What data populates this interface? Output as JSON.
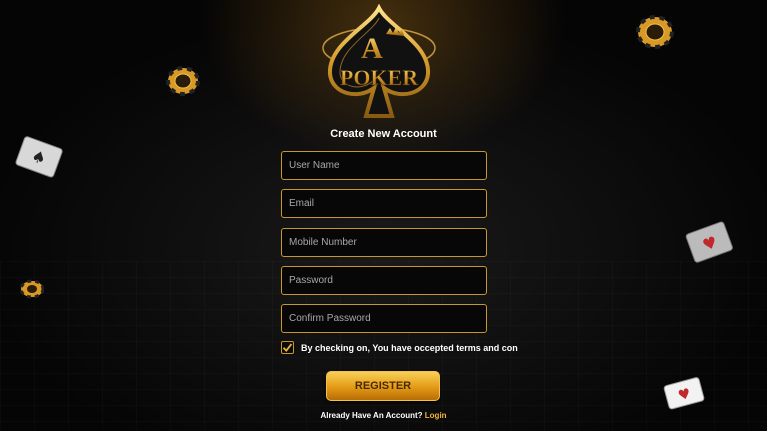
{
  "brand": {
    "logo_letter": "A",
    "logo_word": "POKER"
  },
  "form": {
    "title": "Create New Account",
    "fields": [
      {
        "name": "username",
        "placeholder": "User Name"
      },
      {
        "name": "email",
        "placeholder": "Email"
      },
      {
        "name": "mobile",
        "placeholder": "Mobile Number"
      },
      {
        "name": "password",
        "placeholder": "Password"
      },
      {
        "name": "confirm_password",
        "placeholder": "Confirm Password"
      }
    ],
    "terms_checked": true,
    "terms_text": "By checking on, You have occepted terms and con",
    "register_label": "REGISTER",
    "login_prompt": "Already Have An Account?",
    "login_link": "Login"
  },
  "colors": {
    "accent_gold": "#c9962e",
    "button_gold": "#f0b43a",
    "background": "#0a0a0a"
  },
  "decorations": [
    "poker-chip-icon",
    "playing-card-icon"
  ]
}
